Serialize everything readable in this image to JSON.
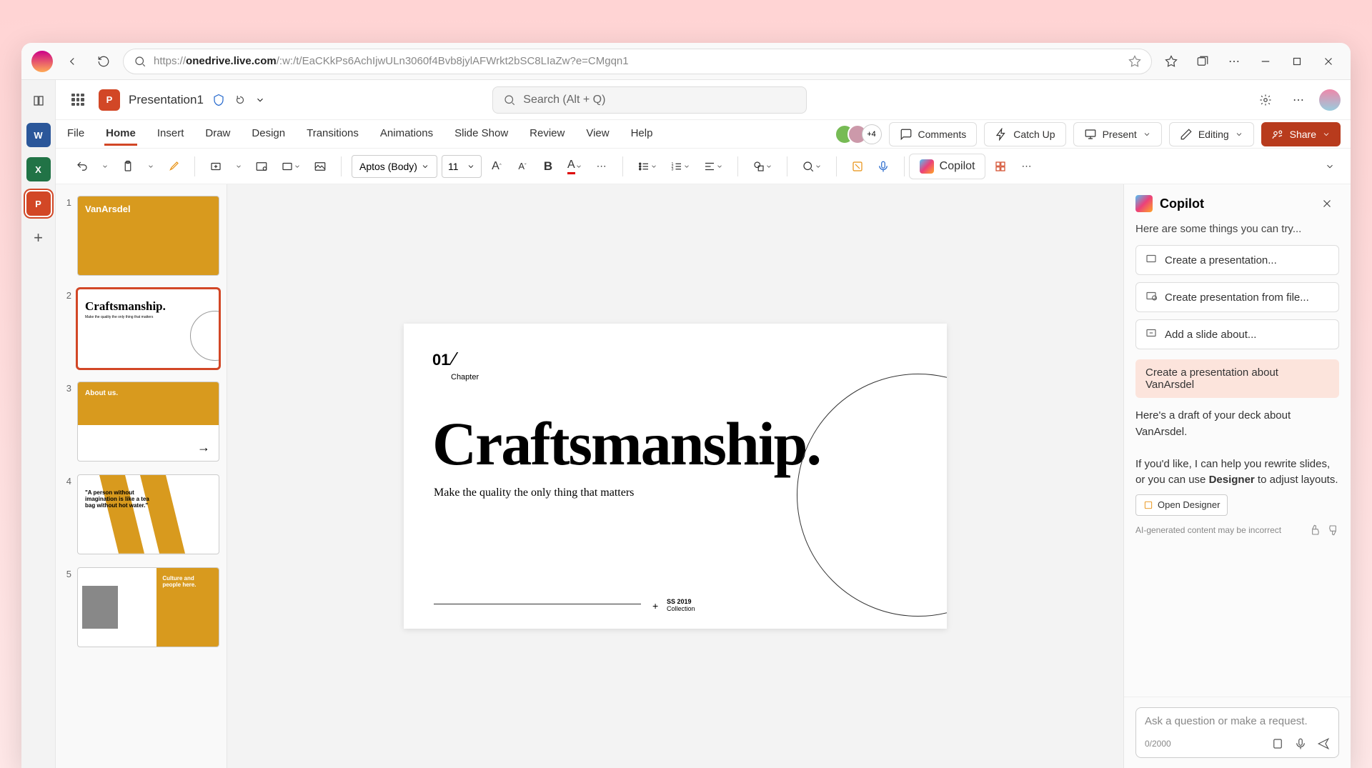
{
  "browser": {
    "url_prefix": "https://",
    "url_host": "onedrive.live.com",
    "url_path": "/:w:/t/EaCKkPs6AchIjwULn3060f4Bvb8jylAFWrkt2bSC8LIaZw?e=CMgqn1"
  },
  "header": {
    "doc_title": "Presentation1",
    "search_placeholder": "Search (Alt + Q)"
  },
  "tabs": [
    "File",
    "Home",
    "Insert",
    "Draw",
    "Design",
    "Transitions",
    "Animations",
    "Slide Show",
    "Review",
    "View",
    "Help"
  ],
  "active_tab": "Home",
  "right": {
    "more_count": "+4",
    "comments": "Comments",
    "catchup": "Catch Up",
    "present": "Present",
    "editing": "Editing",
    "share": "Share"
  },
  "toolbar": {
    "font_name": "Aptos (Body)",
    "font_size": "11",
    "copilot_label": "Copilot"
  },
  "slides": [
    {
      "num": "1",
      "type": "title",
      "bg": "#d89a1e",
      "text": "VanArsdel"
    },
    {
      "num": "2",
      "type": "craft",
      "title": "Craftsmanship.",
      "sub": "Make the quality the only thing that matters"
    },
    {
      "num": "3",
      "type": "about",
      "title": "About us."
    },
    {
      "num": "4",
      "type": "quote",
      "text": "\"A person without imagination is like a tea bag without hot water.\""
    },
    {
      "num": "5",
      "type": "culture",
      "title": "Culture and people here."
    }
  ],
  "main_slide": {
    "chapter_num": "01",
    "chapter_label": "Chapter",
    "title": "Craftsmanship.",
    "subtitle": "Make the quality the only thing that matters",
    "footer_year": "SS 2019",
    "footer_label": "Collection"
  },
  "copilot": {
    "title": "Copilot",
    "intro": "Here are some things you can try...",
    "suggestions": [
      "Create a presentation...",
      "Create presentation from file...",
      "Add a slide about..."
    ],
    "user_message": "Create a presentation about VanArsdel",
    "response1": "Here's a draft of your deck about VanArsdel.",
    "response2_a": "If you'd like, I can help you rewrite slides, or you can use ",
    "response2_b": "Designer",
    "response2_c": " to adjust layouts.",
    "chip": "Open Designer",
    "warning": "AI-generated content may be incorrect",
    "placeholder": "Ask a question or make a request.",
    "counter": "0/2000"
  }
}
